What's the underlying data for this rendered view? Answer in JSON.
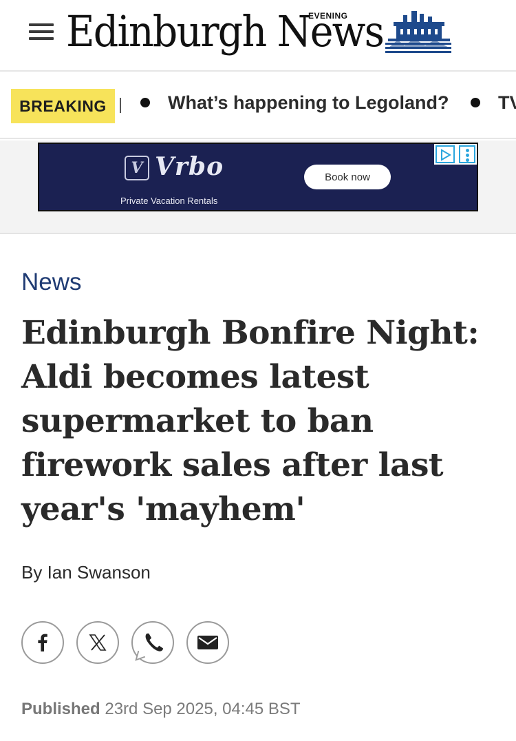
{
  "header": {
    "logo_text": "Edinburgh News",
    "logo_superscript": "EVENING",
    "menu_icon": "hamburger-menu-icon"
  },
  "breaking": {
    "badge": "BREAKING",
    "items": [
      "What’s happening to Legoland?",
      "TV"
    ]
  },
  "ad": {
    "brand": "Vrbo",
    "logo_mark": "V",
    "tagline": "Private Vacation Rentals",
    "cta": "Book now",
    "choices_icons": [
      "adchoices-play-icon",
      "more-options-icon"
    ],
    "accent_color": "#1b2152",
    "choices_color": "#2ba6de"
  },
  "article": {
    "category": "News",
    "headline": "Edinburgh Bonfire Night: Aldi becomes latest supermarket to ban firework sales after last year's 'mayhem'",
    "byline": "By Ian Swanson",
    "share": [
      "facebook-icon",
      "x-icon",
      "whatsapp-icon",
      "email-icon"
    ],
    "published_label": "Published",
    "published_date": "23rd Sep 2025, 04:45 BST"
  },
  "colors": {
    "breaking_badge": "#f7e35a",
    "category_link": "#1f3b73",
    "headline": "#2a2a2a"
  }
}
